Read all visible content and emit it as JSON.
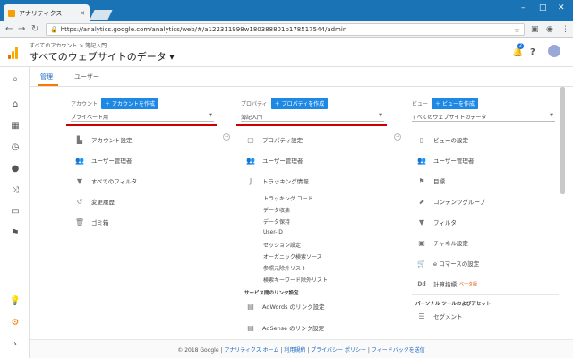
{
  "browser": {
    "tab_title": "アナリティクス",
    "url": "https://analytics.google.com/analytics/web/#/a122311998w180388801p178517544/admin"
  },
  "header": {
    "breadcrumb": "すべてのアカウント > 簿記入門",
    "title": "すべてのウェブサイトのデータ ▾",
    "bell_count": "2"
  },
  "tabs": {
    "admin": "管理",
    "user": "ユーザー"
  },
  "account": {
    "label": "アカウント",
    "create": "アカウントを作成",
    "selected": "プライベート用",
    "items": [
      "アカウント設定",
      "ユーザー管理者",
      "すべてのフィルタ",
      "変更履歴",
      "ゴミ箱"
    ]
  },
  "property": {
    "label": "プロパティ",
    "create": "プロパティを作成",
    "selected": "簿記入門",
    "items": [
      "プロパティ設定",
      "ユーザー管理者",
      "トラッキング情報"
    ],
    "tracking_sub": [
      "トラッキング コード",
      "データ収集",
      "データ保持",
      "User-ID",
      "セッション設定",
      "オーガニック検索ソース",
      "参照元除外リスト",
      "検索キーワード除外リスト"
    ],
    "links_header": "サービス間のリンク設定",
    "links": [
      "AdWords のリンク設定",
      "AdSense のリンク設定"
    ]
  },
  "view": {
    "label": "ビュー",
    "create": "ビューを作成",
    "selected": "すべてのウェブサイトのデータ",
    "items": [
      "ビューの設定",
      "ユーザー管理者",
      "目標",
      "コンテンツグループ",
      "フィルタ",
      "チャネル設定",
      "e コマースの設定",
      "計算指標"
    ],
    "beta": "ベータ版",
    "tools_header": "パーソナル ツールおよびアセット",
    "tools": [
      "セグメント"
    ]
  },
  "footer": {
    "copyright": "© 2018 Google",
    "links": [
      "アナリティクス ホーム",
      "利用規約",
      "プライバシー ポリシー",
      "フィードバックを送信"
    ]
  },
  "colors": {
    "accent": "#1e88e5",
    "highlight": "#cc0000",
    "tab_underline": "#f57c00"
  }
}
